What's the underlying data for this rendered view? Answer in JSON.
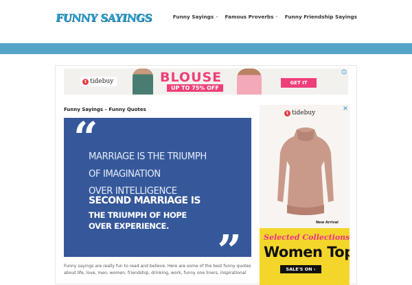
{
  "header": {
    "logo_text": "FUNNY SAYINGS",
    "nav": [
      {
        "label": "Funny Sayings",
        "has_submenu": true
      },
      {
        "label": "Famous Proverbs",
        "has_submenu": true
      },
      {
        "label": "Funny Friendship Sayings",
        "has_submenu": false
      }
    ],
    "submenu_caret": "»",
    "accent_color": "#54a4c7"
  },
  "top_ad": {
    "brand": "tidebuy",
    "brand_mark": "t",
    "headline": "BLOUSE",
    "subline": "UP TO 75% OFF",
    "cta": "GET IT"
  },
  "post": {
    "title": "Funny Sayings – Funny Quotes",
    "quote_line1": "MARRIAGE IS THE TRIUMPH\nOF IMAGINATION\nOVER INTELLIGENCE",
    "quote_line2": "SECOND MARRIAGE IS",
    "quote_line3": "THE TRIUMPH OF HOPE\nOVER EXPERIENCE.",
    "quote_open": "“",
    "quote_close": "”",
    "body": "Funny sayings are really fun to read and believe. Here are some of the best funny quotes about life, love, men, women, friendship, drinking, work, funny one liners, inspirational"
  },
  "side_ad": {
    "brand": "tidebuy",
    "brand_mark": "t",
    "tag": "New Arrival",
    "collection": "Selected Collections",
    "headline": "Women Tops",
    "cta": "SALE'S ON ›"
  }
}
